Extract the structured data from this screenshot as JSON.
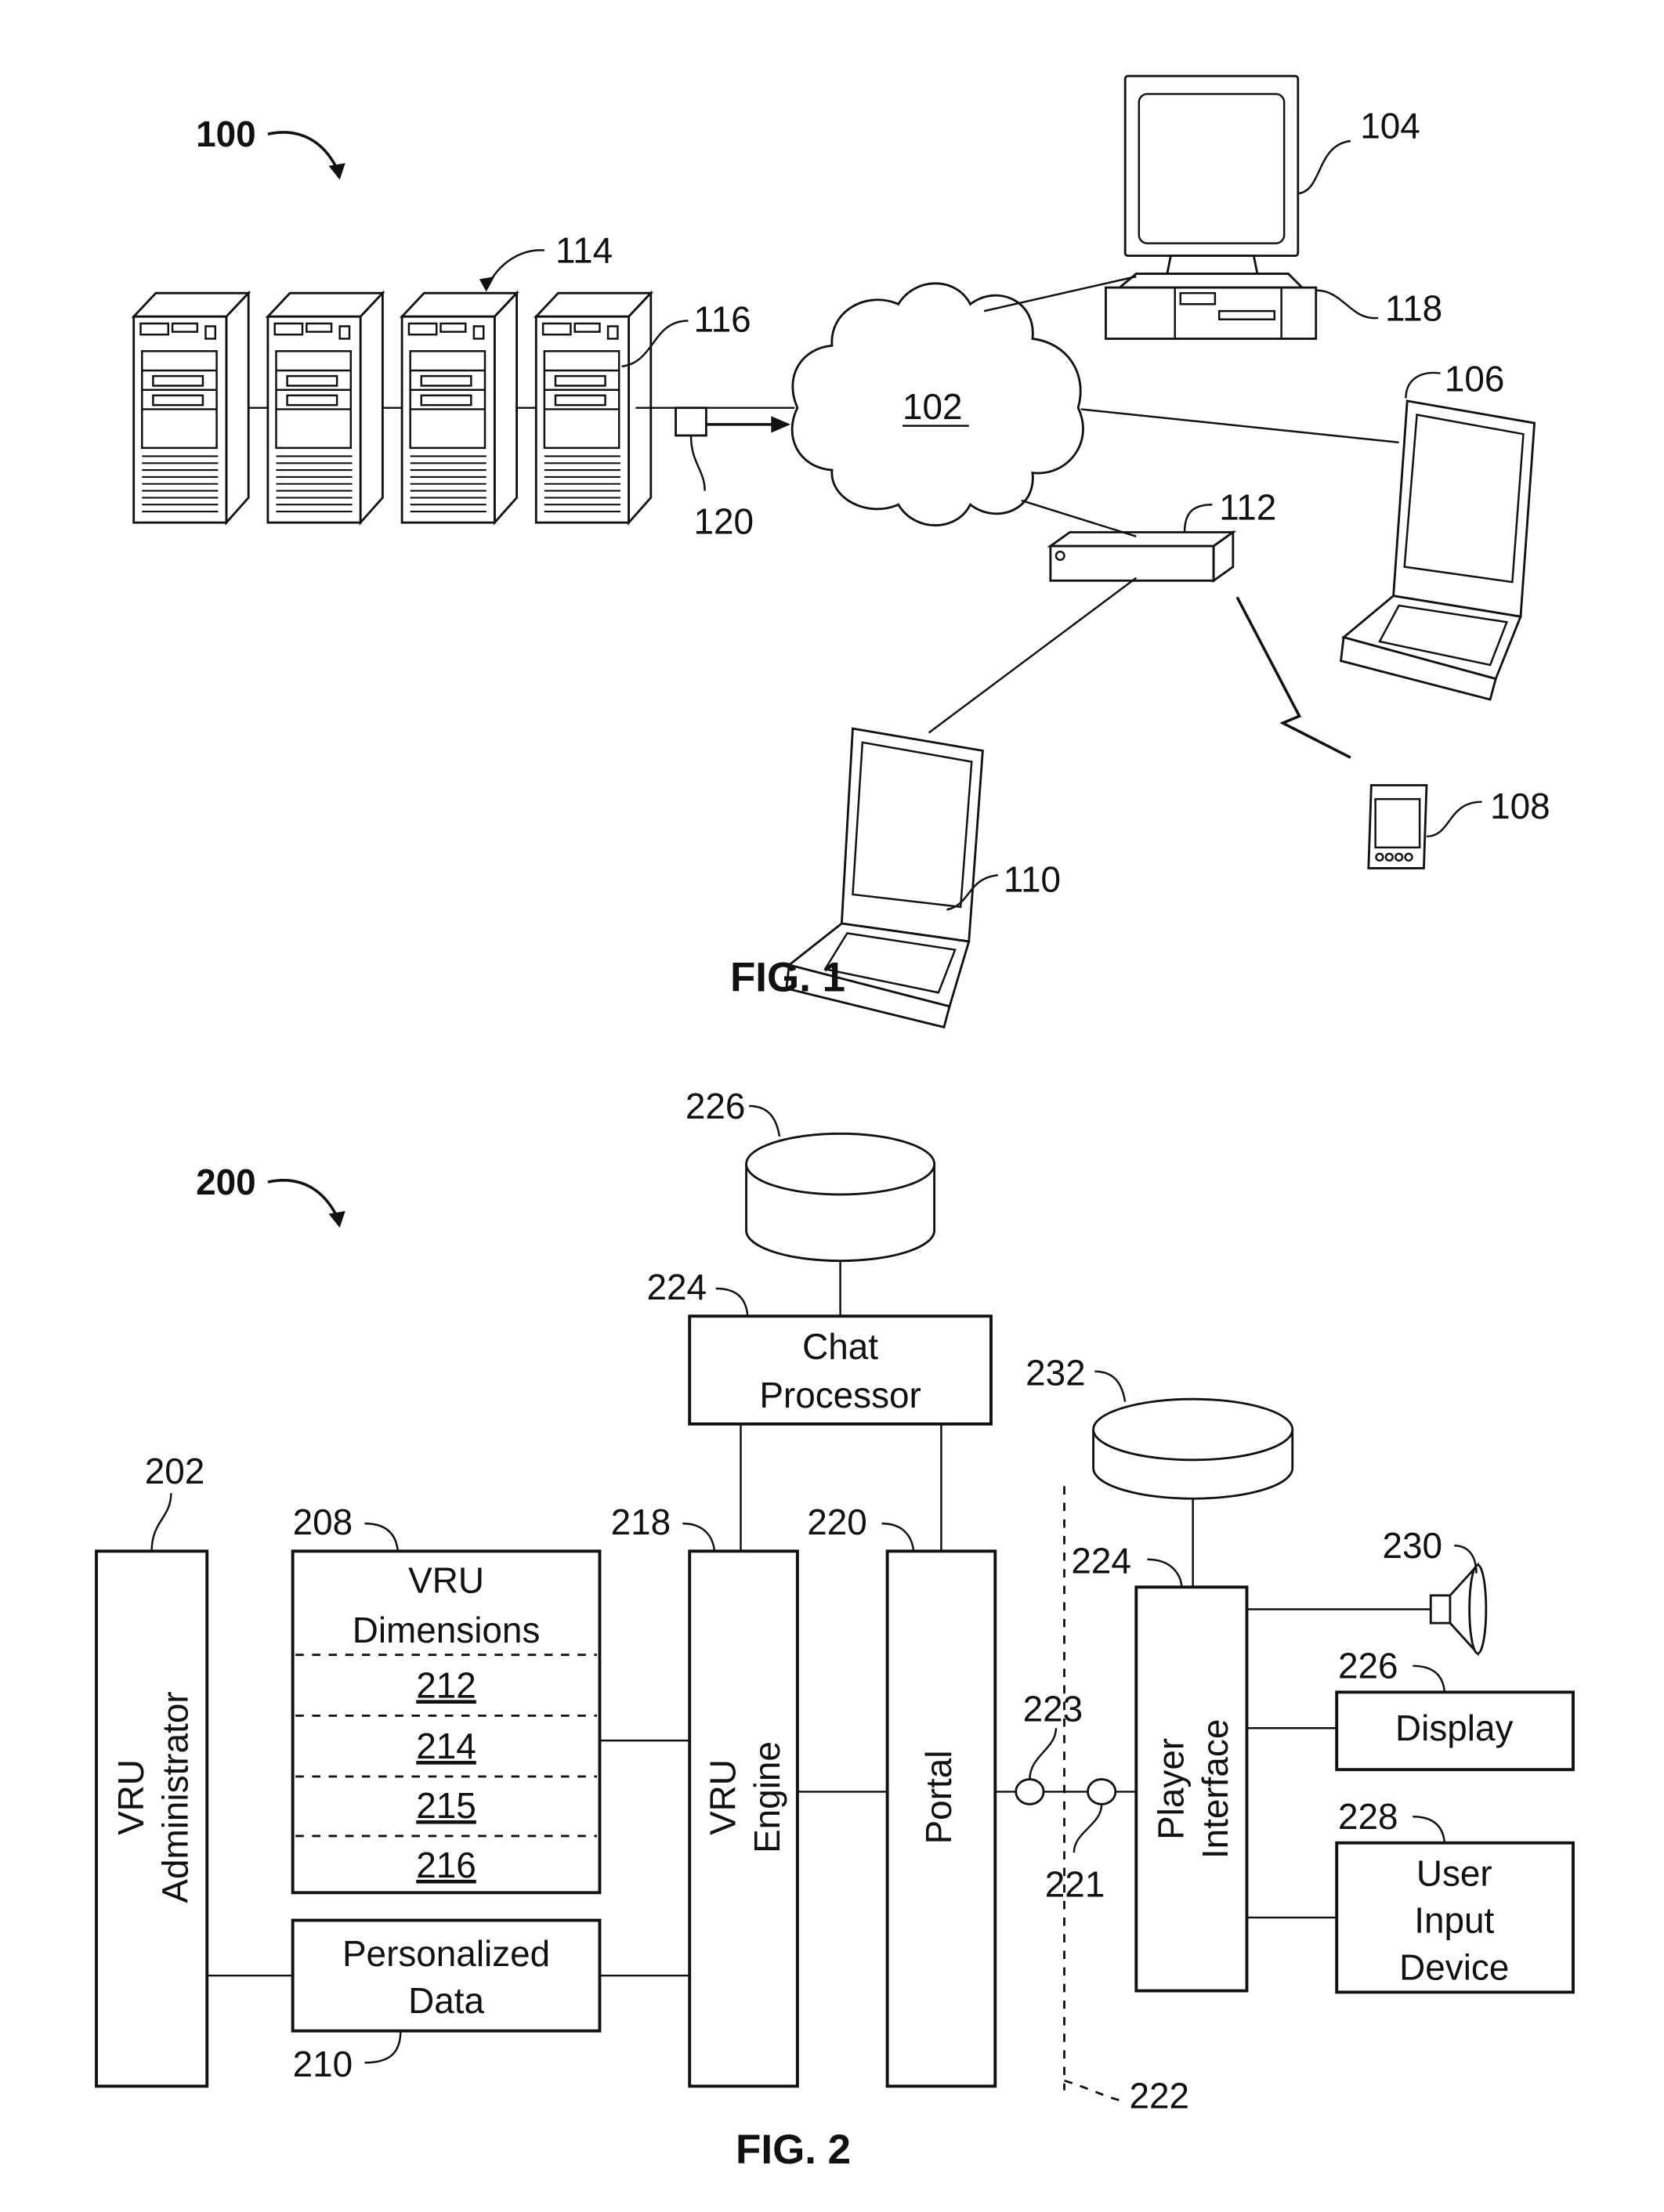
{
  "fig1": {
    "caption": "FIG. 1",
    "system_ref": "100",
    "network": {
      "ref": "102"
    },
    "desktop_monitor": {
      "ref": "104"
    },
    "desktop_tower": {
      "ref": "118"
    },
    "laptop_right": {
      "ref": "106"
    },
    "handheld": {
      "ref": "108"
    },
    "laptop_bottom": {
      "ref": "110"
    },
    "router": {
      "ref": "112"
    },
    "server_cluster": {
      "ref": "114",
      "server_count": 4
    },
    "server_component": {
      "ref": "116"
    },
    "connector": {
      "ref": "120"
    }
  },
  "fig2": {
    "caption": "FIG. 2",
    "system_ref": "200",
    "chat_db": {
      "ref": "226"
    },
    "chat_processor": {
      "ref": "224",
      "label_line1": "Chat",
      "label_line2": "Processor"
    },
    "player_db": {
      "ref": "232"
    },
    "vru_administrator": {
      "ref": "202",
      "label_line1": "VRU",
      "label_line2": "Administrator"
    },
    "vru_dimensions": {
      "ref": "208",
      "label_line1": "VRU",
      "label_line2": "Dimensions",
      "sections": [
        "212",
        "214",
        "215",
        "216"
      ]
    },
    "personalized_data": {
      "ref": "210",
      "label_line1": "Personalized",
      "label_line2": "Data"
    },
    "vru_engine": {
      "ref": "218",
      "label_line1": "VRU",
      "label_line2": "Engine"
    },
    "portal": {
      "ref": "220",
      "label": "Portal"
    },
    "node_left": {
      "ref": "223"
    },
    "node_right": {
      "ref": "221"
    },
    "boundary": {
      "ref": "222"
    },
    "player_interface": {
      "ref": "224",
      "label_line1": "Player",
      "label_line2": "Interface"
    },
    "speaker": {
      "ref": "230"
    },
    "display": {
      "ref": "226",
      "label": "Display"
    },
    "user_input_device": {
      "ref": "228",
      "label_line1": "User",
      "label_line2": "Input",
      "label_line3": "Device"
    }
  }
}
